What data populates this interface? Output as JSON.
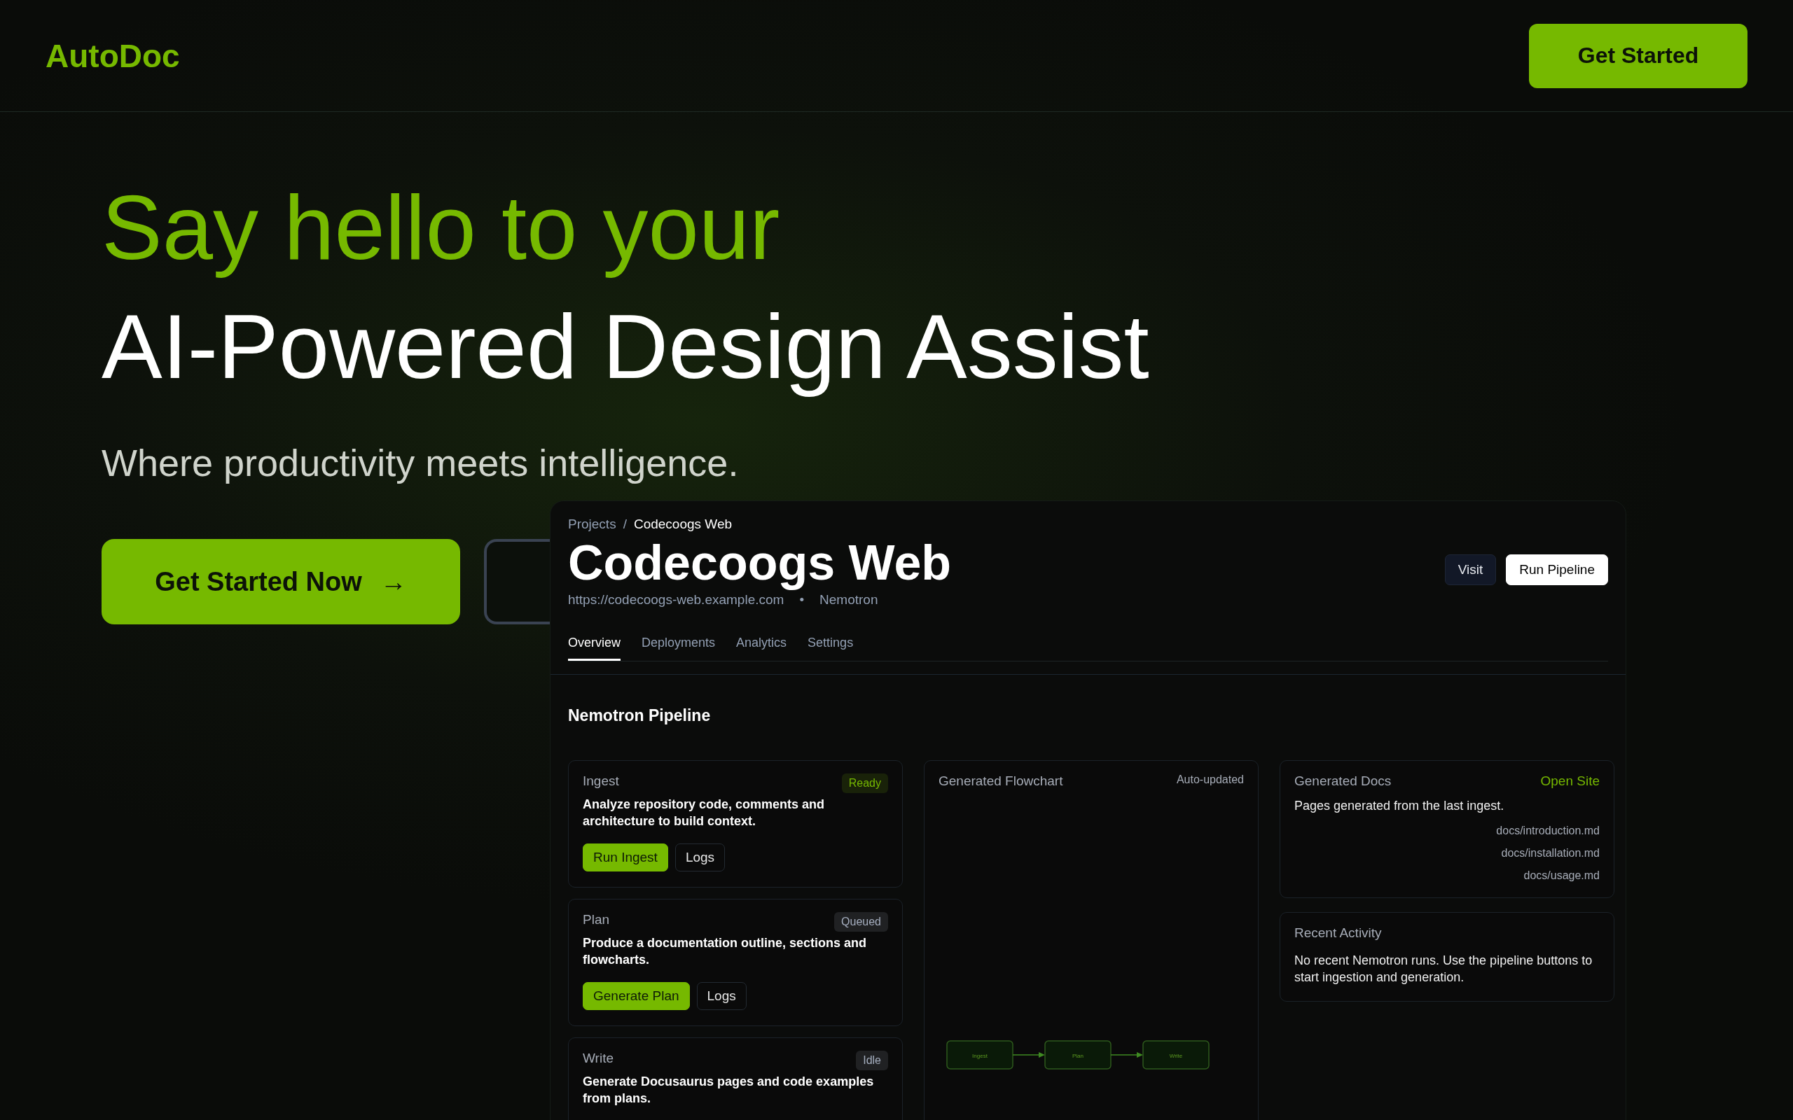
{
  "header": {
    "logo": "AutoDoc",
    "cta": "Get Started"
  },
  "hero": {
    "title_line_1": "Say hello to your",
    "title_line_2": "AI-Powered Design Assist",
    "subtitle": "Where productivity meets intelligence.",
    "primary_button": "Get Started Now",
    "primary_button_icon": "→"
  },
  "project": {
    "breadcrumb": [
      "Projects",
      "Codecoogs Web"
    ],
    "breadcrumb_separator": "/",
    "title": "Codecoogs Web",
    "url": "https://codecoogs-web.example.com",
    "separator": "•",
    "model": "Nemotron",
    "actions": [
      {
        "label": "Visit",
        "kind": "secondary"
      },
      {
        "label": "Run Pipeline",
        "kind": "light"
      }
    ],
    "tabs": [
      {
        "label": "Overview",
        "selected": true
      },
      {
        "label": "Deployments",
        "selected": false
      },
      {
        "label": "Analytics",
        "selected": false
      },
      {
        "label": "Settings",
        "selected": false
      }
    ]
  },
  "pipeline": {
    "title": "Nemotron Pipeline",
    "steps": [
      {
        "name": "Ingest",
        "badge": "Ready",
        "color": "#76b900",
        "description": "Analyze repository code, comments and architecture to build context.",
        "buttons": [
          "Run Ingest",
          "Logs"
        ]
      },
      {
        "name": "Plan",
        "badge": "Queued",
        "color": "#a5aebf",
        "description": "Produce a documentation outline, sections and flowcharts.",
        "buttons": [
          "Generate Plan",
          "Logs"
        ]
      },
      {
        "name": "Write",
        "badge": "Idle",
        "color": "#a5aebf",
        "description": "Generate Docusaurus pages and code examples from plans."
      }
    ],
    "flowchart": {
      "title": "Generated Flowchart",
      "note": "Auto-updated",
      "nodes": [
        "Ingest",
        "Plan",
        "Write"
      ]
    },
    "docs": {
      "title": "Generated Docs",
      "link": "Open Site",
      "description": "Pages generated from the last ingest.",
      "files": [
        "docs/introduction.md",
        "docs/installation.md",
        "docs/usage.md"
      ]
    },
    "activity": {
      "title": "Recent Activity",
      "text": "No recent Nemotron runs. Use the pipeline buttons to start ingestion and generation."
    }
  }
}
